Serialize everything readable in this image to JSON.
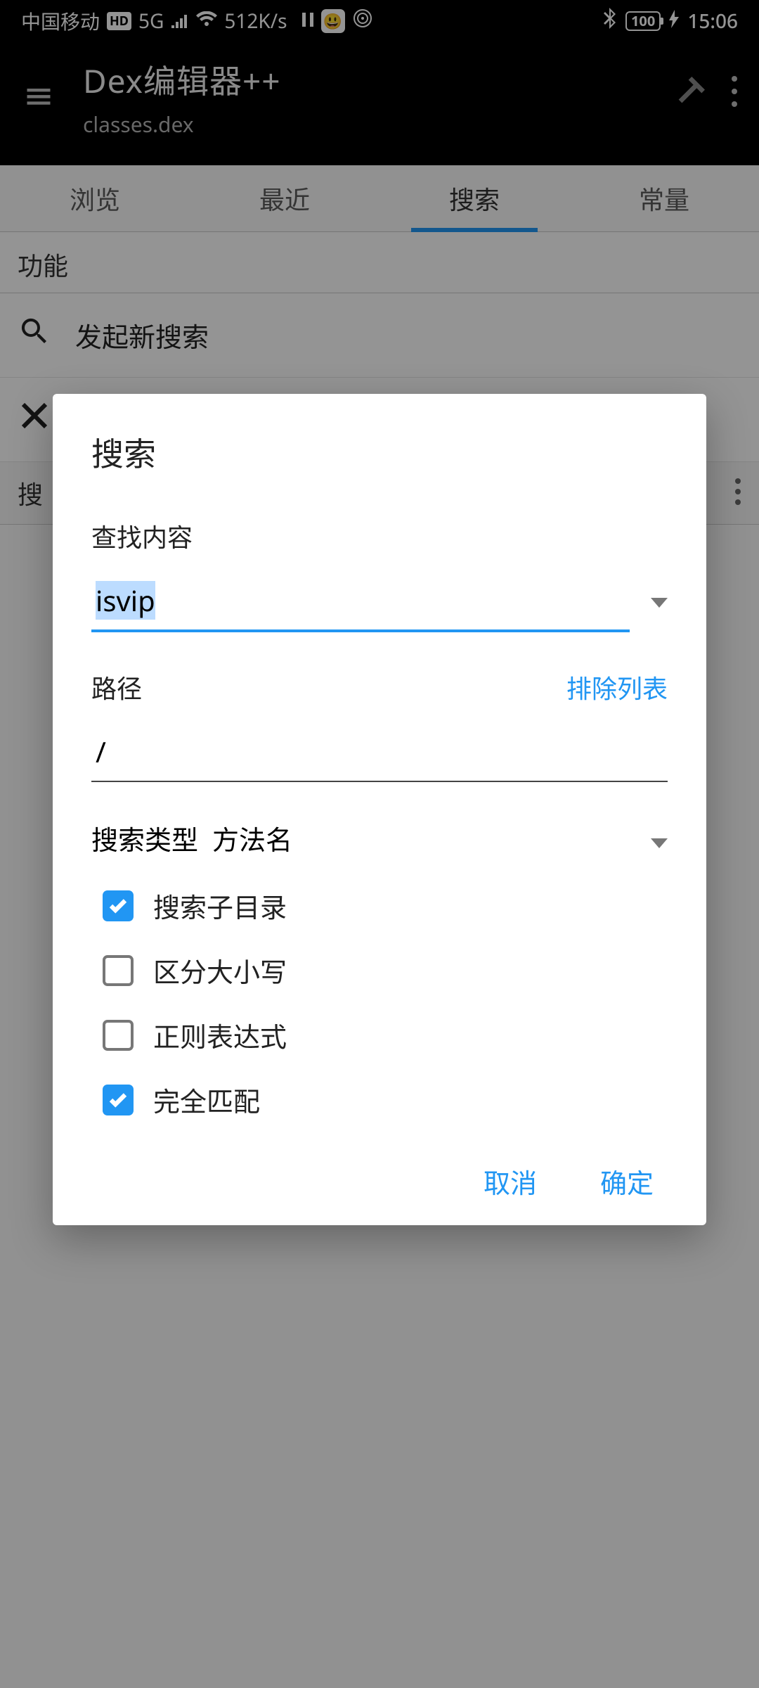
{
  "status": {
    "carrier": "中国移动",
    "hd": "HD",
    "net": "5G",
    "speed": "512K/s",
    "battery": "100",
    "time": "15:06"
  },
  "appbar": {
    "title": "Dex编辑器++",
    "subtitle": "classes.dex"
  },
  "tabs": {
    "browse": "浏览",
    "recent": "最近",
    "search": "搜索",
    "constants": "常量"
  },
  "page": {
    "section_label": "功能",
    "new_search": "发起新搜索",
    "results_prefix": "搜"
  },
  "dialog": {
    "title": "搜索",
    "find_label": "查找内容",
    "find_value": "isvip",
    "path_label": "路径",
    "exclude_link": "排除列表",
    "path_value": "/",
    "type_label": "搜索类型",
    "type_value": "方法名",
    "checks": {
      "subdir": "搜索子目录",
      "case": "区分大小写",
      "regex": "正则表达式",
      "exact": "完全匹配"
    },
    "cancel": "取消",
    "ok": "确定"
  }
}
